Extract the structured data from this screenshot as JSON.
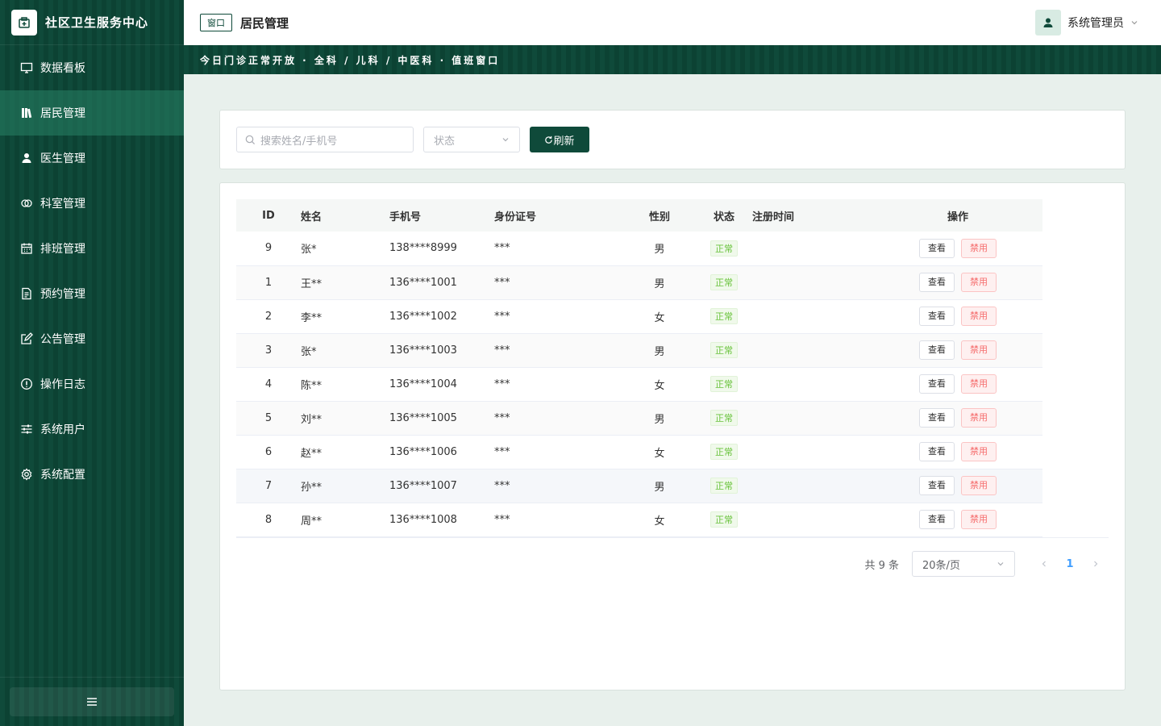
{
  "app": {
    "title": "社区卫生服务中心"
  },
  "sidebar": {
    "items": [
      {
        "label": "数据看板",
        "icon": "monitor-icon"
      },
      {
        "label": "居民管理",
        "icon": "book-icon",
        "active": true
      },
      {
        "label": "医生管理",
        "icon": "user-icon"
      },
      {
        "label": "科室管理",
        "icon": "link-icon"
      },
      {
        "label": "排班管理",
        "icon": "calendar-icon"
      },
      {
        "label": "预约管理",
        "icon": "document-icon"
      },
      {
        "label": "公告管理",
        "icon": "edit-icon"
      },
      {
        "label": "操作日志",
        "icon": "info-icon"
      },
      {
        "label": "系统用户",
        "icon": "sliders-icon"
      },
      {
        "label": "系统配置",
        "icon": "gear-icon"
      }
    ]
  },
  "header": {
    "badge": "窗口",
    "title": "居民管理",
    "user": "系统管理员"
  },
  "banner": {
    "text": "今日门诊正常开放 · 全科 / 儿科 / 中医科 · 值班窗口"
  },
  "filter": {
    "search_placeholder": "搜索姓名/手机号",
    "status_placeholder": "状态",
    "refresh_label": "刷新"
  },
  "table": {
    "headers": [
      "ID",
      "姓名",
      "手机号",
      "身份证号",
      "性别",
      "状态",
      "注册时间",
      "操作"
    ],
    "rows": [
      {
        "id": "9",
        "name": "张*",
        "phone": "138****8999",
        "idcard": "***",
        "gender": "男",
        "status": "正常",
        "time": ""
      },
      {
        "id": "1",
        "name": "王**",
        "phone": "136****1001",
        "idcard": "***",
        "gender": "男",
        "status": "正常",
        "time": ""
      },
      {
        "id": "2",
        "name": "李**",
        "phone": "136****1002",
        "idcard": "***",
        "gender": "女",
        "status": "正常",
        "time": ""
      },
      {
        "id": "3",
        "name": "张*",
        "phone": "136****1003",
        "idcard": "***",
        "gender": "男",
        "status": "正常",
        "time": ""
      },
      {
        "id": "4",
        "name": "陈**",
        "phone": "136****1004",
        "idcard": "***",
        "gender": "女",
        "status": "正常",
        "time": ""
      },
      {
        "id": "5",
        "name": "刘**",
        "phone": "136****1005",
        "idcard": "***",
        "gender": "男",
        "status": "正常",
        "time": ""
      },
      {
        "id": "6",
        "name": "赵**",
        "phone": "136****1006",
        "idcard": "***",
        "gender": "女",
        "status": "正常",
        "time": ""
      },
      {
        "id": "7",
        "name": "孙**",
        "phone": "136****1007",
        "idcard": "***",
        "gender": "男",
        "status": "正常",
        "time": ""
      },
      {
        "id": "8",
        "name": "周**",
        "phone": "136****1008",
        "idcard": "***",
        "gender": "女",
        "status": "正常",
        "time": ""
      }
    ],
    "view_label": "查看",
    "disable_label": "禁用"
  },
  "pager": {
    "total": "共 9 条",
    "page_size": "20条/页",
    "current": "1"
  },
  "colors": {
    "brand": "#0f4a3a",
    "success": "#67c23a",
    "danger": "#f56c6c"
  }
}
